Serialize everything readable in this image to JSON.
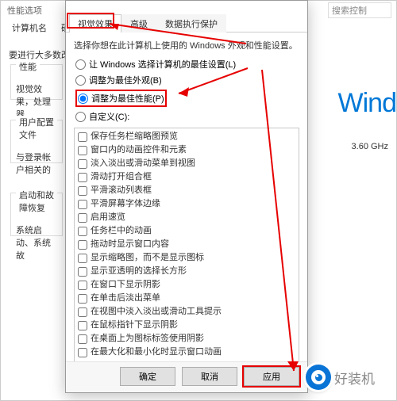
{
  "colors": {
    "accent": "#e60000",
    "link": "#0078d7"
  },
  "background_window": {
    "title_hint": "性能选项",
    "search_placeholder": "搜索控制",
    "tabs": [
      "计算机名",
      "硬件"
    ],
    "message": "要进行大多数改",
    "groups": {
      "perf": {
        "title": "性能",
        "content": "视觉效果，处理器"
      },
      "user": {
        "title": "用户配置文件",
        "content": "与登录帐户相关的"
      },
      "startup": {
        "title": "启动和故障恢复",
        "content": "系统启动、系统故"
      }
    },
    "windows_text": "Wind",
    "ghz": "3.60 GHz"
  },
  "dialog": {
    "title": "性能选项",
    "tabs": [
      {
        "label": "视觉效果",
        "active": true
      },
      {
        "label": "高级",
        "active": false
      },
      {
        "label": "数据执行保护",
        "active": false
      }
    ],
    "instruction": "选择你想在此计算机上使用的 Windows 外观和性能设置。",
    "radios": [
      {
        "label": "让 Windows 选择计算机的最佳设置(L)",
        "checked": false
      },
      {
        "label": "调整为最佳外观(B)",
        "checked": false
      },
      {
        "label": "调整为最佳性能(P)",
        "checked": true
      },
      {
        "label": "自定义(C):",
        "checked": false
      }
    ],
    "checks": [
      "保存任务栏缩略图预览",
      "窗口内的动画控件和元素",
      "淡入淡出或滑动菜单到视图",
      "滑动打开组合框",
      "平滑滚动列表框",
      "平滑屏幕字体边缘",
      "启用速览",
      "任务栏中的动画",
      "拖动时显示窗口内容",
      "显示缩略图，而不是显示图标",
      "显示亚透明的选择长方形",
      "在窗口下显示阴影",
      "在单击后淡出菜单",
      "在视图中淡入淡出或滑动工具提示",
      "在鼠标指针下显示阴影",
      "在桌面上为图标标签使用阴影",
      "在最大化和最小化时显示窗口动画"
    ],
    "buttons": {
      "ok": "确定",
      "cancel": "取消",
      "apply": "应用"
    }
  },
  "watermark": "好装机"
}
